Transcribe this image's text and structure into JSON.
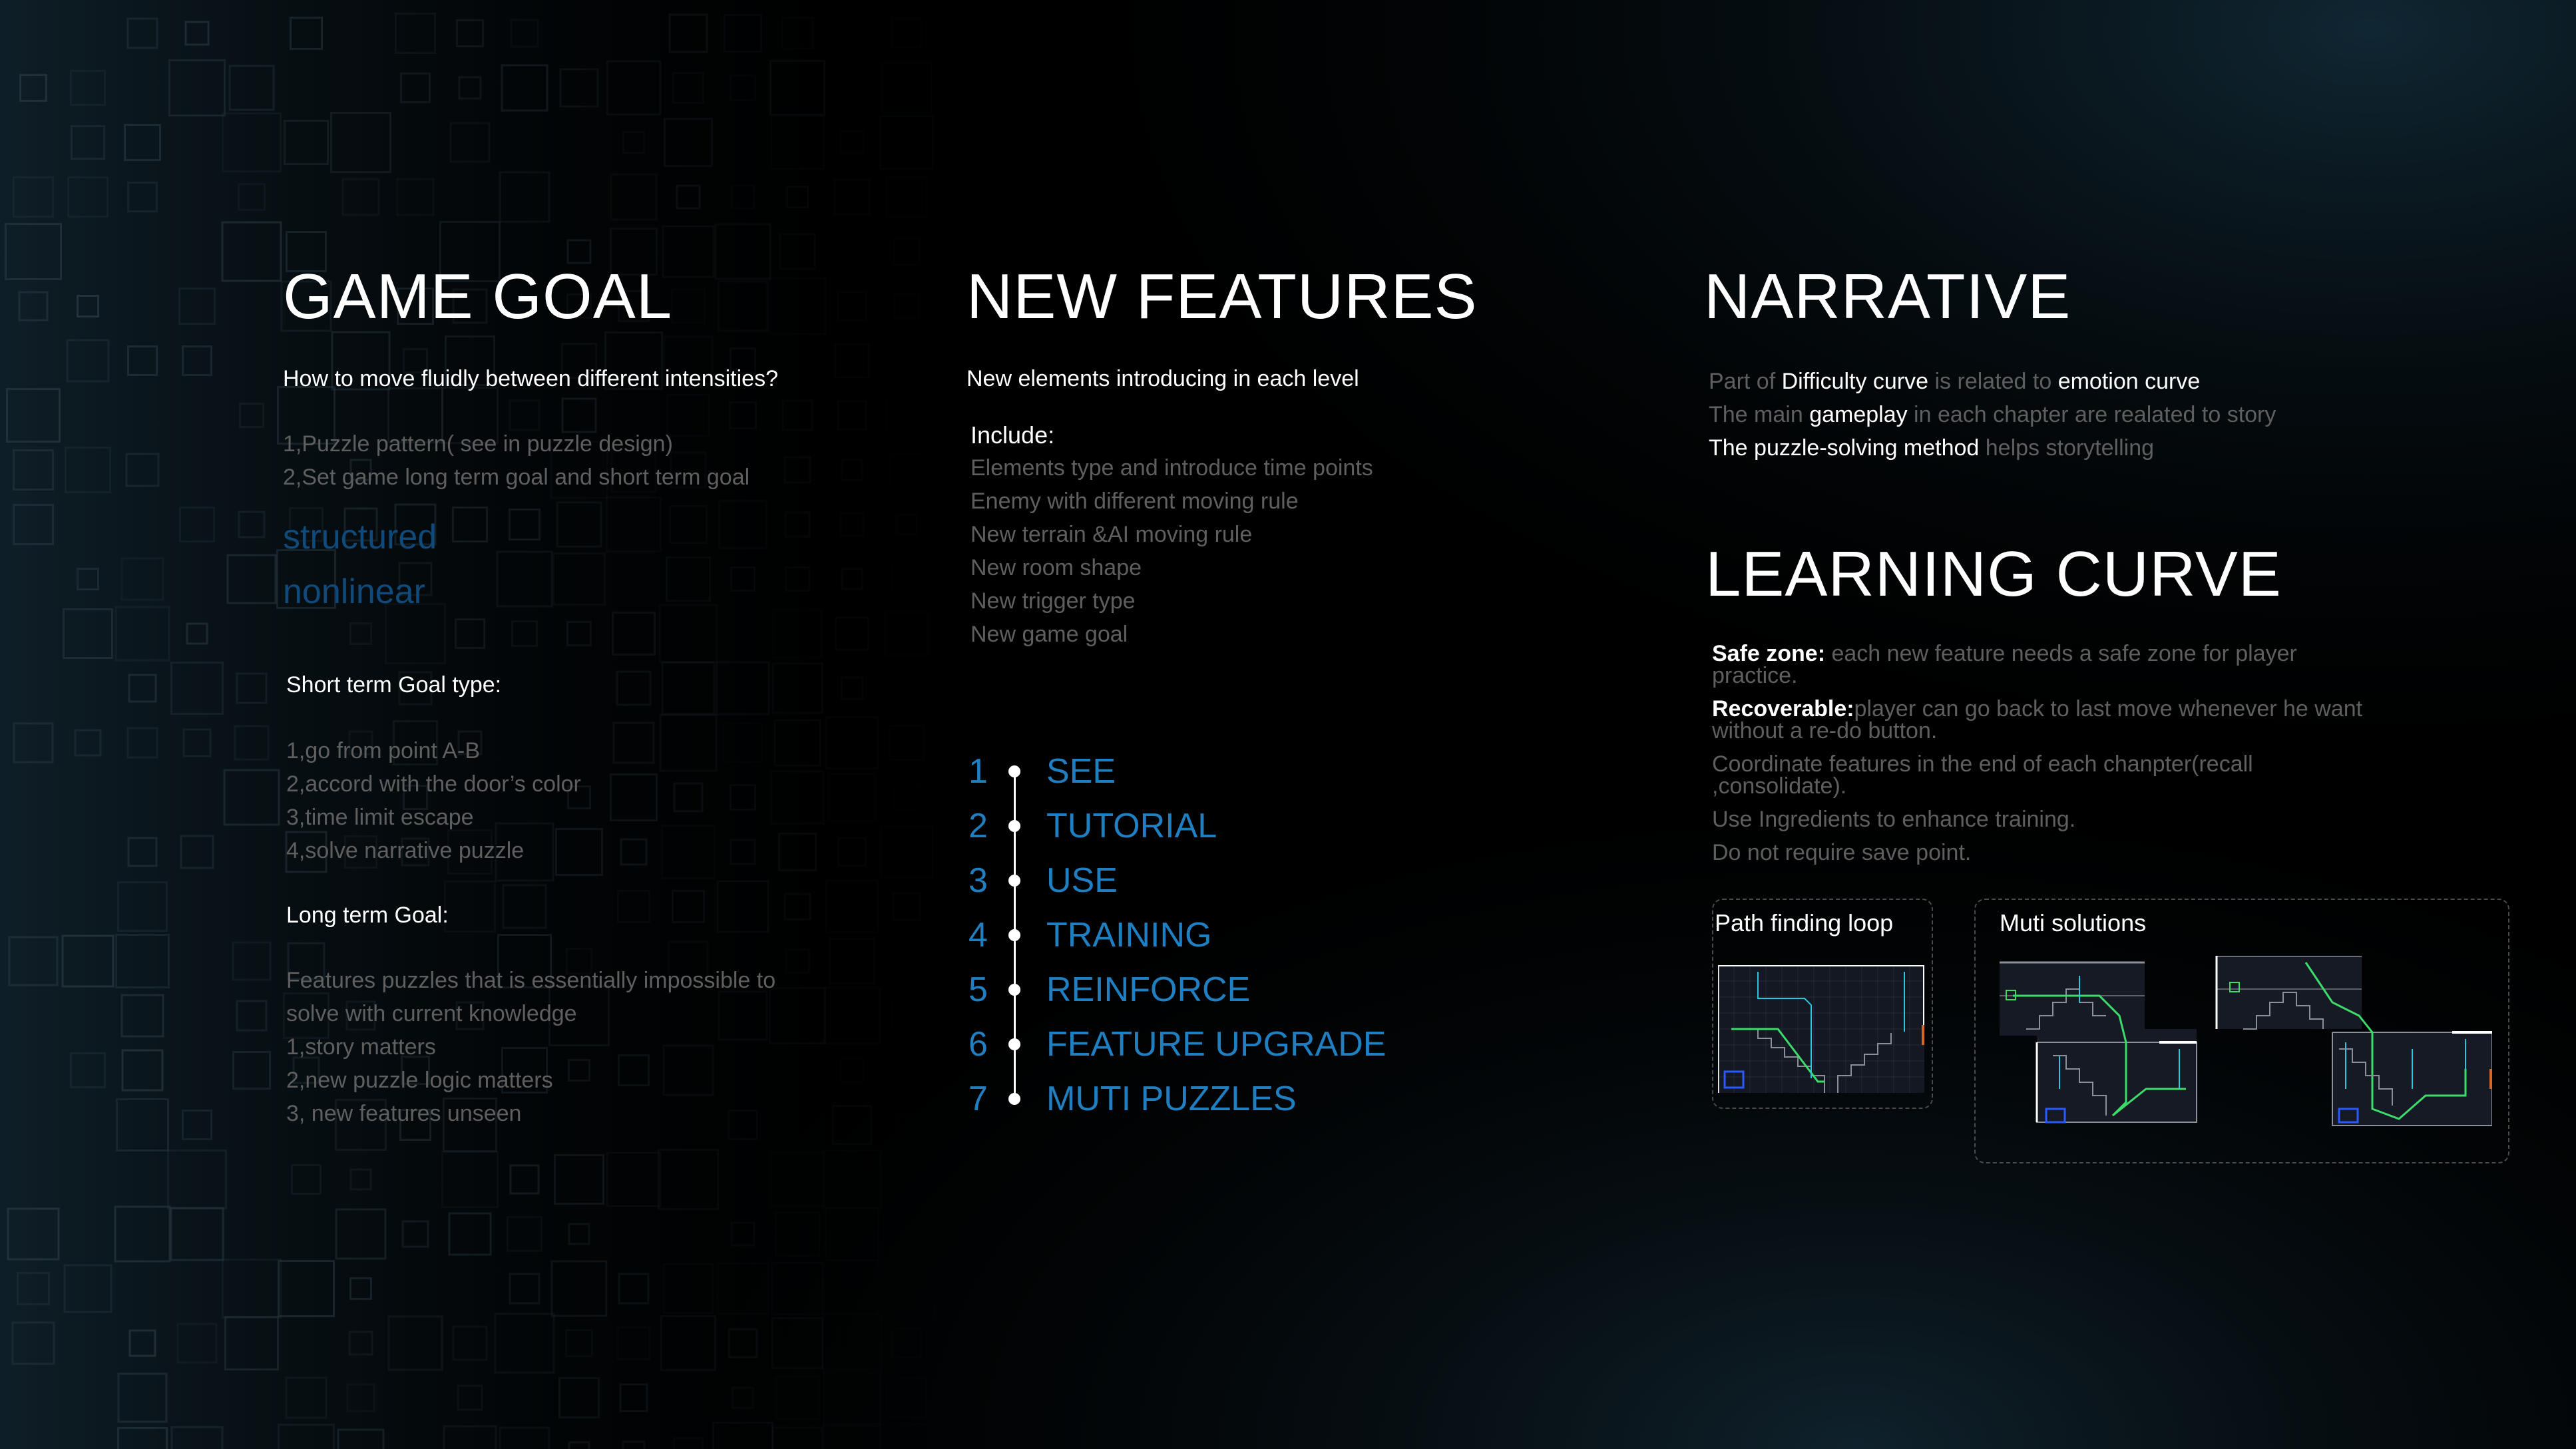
{
  "game_goal": {
    "title": "GAME GOAL",
    "question": "How to move fluidly between different intensities?",
    "points": [
      "1,Puzzle pattern( see in puzzle design)",
      "2,Set game long term goal and short term goal"
    ],
    "keywords": [
      "structured",
      "nonlinear"
    ],
    "short_term_title": "Short term Goal type:",
    "short_term_items": [
      "1,go from point A-B",
      "2,accord with the door’s color",
      "3,time limit escape",
      "4,solve narrative puzzle"
    ],
    "long_term_title": "Long term Goal:",
    "long_term_items": [
      "Features puzzles that is essentially impossible to",
      "solve with current knowledge",
      "1,story matters",
      "2,new puzzle logic matters",
      "3, new features unseen"
    ]
  },
  "new_features": {
    "title": "NEW FEATURES",
    "subtitle": "New elements introducing in each level",
    "include_title": "Include:",
    "include_items": [
      "Elements type and introduce time points",
      "Enemy with different moving rule",
      "New terrain &AI moving rule",
      "New room shape",
      "New trigger type",
      "New game goal"
    ],
    "steps": [
      {
        "num": "1",
        "label": "SEE"
      },
      {
        "num": "2",
        "label": "TUTORIAL"
      },
      {
        "num": "3",
        "label": "USE"
      },
      {
        "num": "4",
        "label": "TRAINING"
      },
      {
        "num": "5",
        "label": "REINFORCE"
      },
      {
        "num": "6",
        "label": "FEATURE UPGRADE"
      },
      {
        "num": "7",
        "label": "MUTI PUZZLES"
      }
    ]
  },
  "narrative": {
    "title": "NARRATIVE",
    "line1": {
      "a": "Part of ",
      "b": "Difficulty curve",
      "c": " is related to ",
      "d": "emotion curve"
    },
    "line2": {
      "a": "The main ",
      "b": "gameplay",
      "c": " in each chapter are realated to story"
    },
    "line3": {
      "a": "The puzzle-solving method",
      "b": " helps storytelling"
    }
  },
  "learning_curve": {
    "title": "LEARNING CURVE",
    "safe_label": "Safe zone:",
    "safe_text": " each new feature needs a safe zone for player practice.",
    "recover_label": "Recoverable:",
    "recover_text": "player can go back to last move whenever he want without a re-do button.",
    "coord_text": "Coordinate features in the end of each chanpter(recall ,consolidate).",
    "ingredients_text": "Use Ingredients to enhance training.",
    "save_text": "Do not require save point.",
    "card1_title": "Path finding loop",
    "card2_title": "Muti solutions"
  },
  "colors": {
    "background": "#000000",
    "accent_blue": "#1f7fc0",
    "dim_blue": "#0f4a7a",
    "muted_text": "#5f5f5f",
    "path_green": "#3ddc6a",
    "path_cyan": "#29c6e0"
  }
}
